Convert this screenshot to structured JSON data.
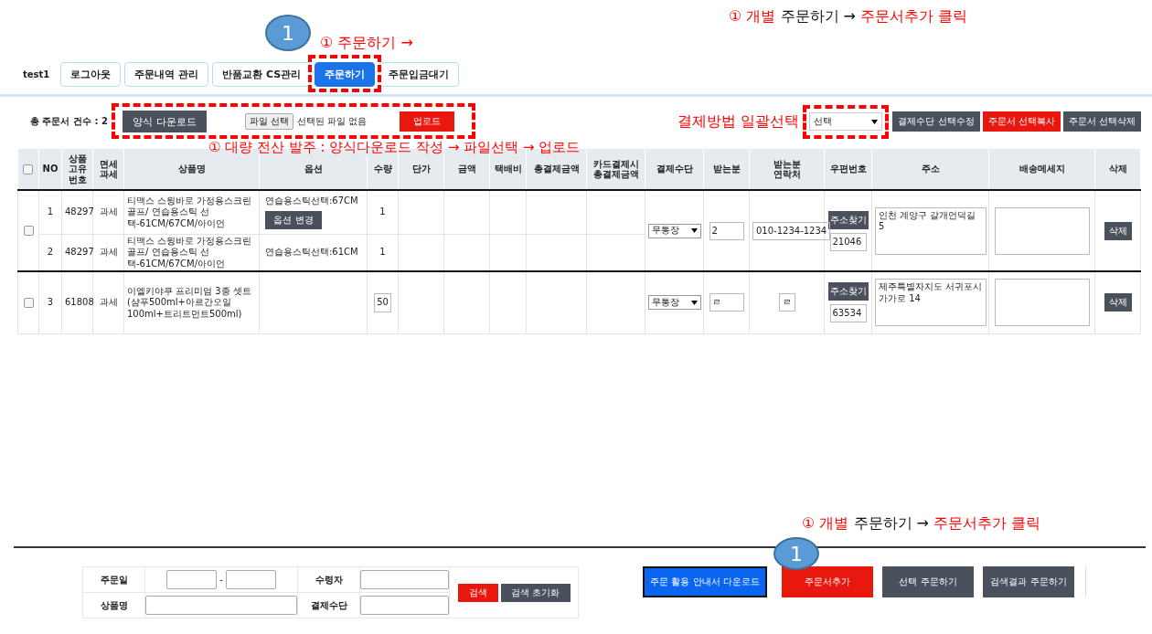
{
  "annotation_top": {
    "segments": [
      {
        "text": "① 개별",
        "emphasis": true
      },
      {
        "text": "주문하기 →",
        "emphasis": false
      },
      {
        "text": "주문서추가 클릭",
        "emphasis": true
      }
    ]
  },
  "step_badges": [
    "1",
    "1"
  ],
  "annotation_tab": "① 주문하기 →",
  "annotation_bulk": "① 대량 전산 발주 :  양식다운로드 작성 → 파일선택 →  업로드",
  "annotation_payment": "결제방법 일괄선택",
  "annotation_bottom": {
    "segments": [
      {
        "text": "① 개별",
        "emphasis": true
      },
      {
        "text": "주문하기 →",
        "emphasis": false
      },
      {
        "text": "주문서추가 클릭",
        "emphasis": true
      }
    ]
  },
  "user": "test1",
  "tabs": [
    {
      "label": "로그아웃",
      "selected": false
    },
    {
      "label": "주문내역 관리",
      "selected": false
    },
    {
      "label": "반품교환 CS관리",
      "selected": false
    },
    {
      "label": "주문하기",
      "selected": true
    },
    {
      "label": "주문입금대기",
      "selected": false
    }
  ],
  "order_count": "총 주문서 건수 : 2",
  "template_button": "양식 다운로드",
  "file_button": "파일 선택",
  "file_status": "선택된 파일 없음",
  "upload_button": "업로드",
  "payment_select": "선택",
  "toolbar_buttons": [
    {
      "label": "결제수단 선택수정",
      "kind": "dark"
    },
    {
      "label": "주문서 선택복사",
      "kind": "danger"
    },
    {
      "label": "주문서 선택삭제",
      "kind": "dark"
    }
  ],
  "table": {
    "all_checked": false,
    "columns": [
      "NO",
      "상품\n고유\n번호",
      "면세\n과세",
      "상품명",
      "옵션",
      "수량",
      "단가",
      "금액",
      "택배비",
      "총결제금액",
      "카드결제시\n총결제금액",
      "결제수단",
      "받는분",
      "받는분\n연락처",
      "우편번호",
      "주소",
      "배송메세지",
      "삭제"
    ],
    "orders": [
      {
        "checked": false,
        "payment": "무통장",
        "recipient": "2",
        "phone": "010-1234-1234",
        "zip_button": "주소찾기",
        "zip": "21046",
        "address": "인천 계양구 갈개언덕길 5",
        "delete_button": "삭제",
        "items": [
          {
            "no": "1",
            "code": "48297",
            "tax": "과세",
            "name": "티맥스 스윙바로 가정용스크린골프/ 연습용스틱 선택-61CM/67CM/아이언",
            "option": "연습용스틱선택:67CM",
            "option_button": "옵션 변경",
            "qty": "1",
            "qty_field": false
          },
          {
            "no": "2",
            "code": "48297",
            "tax": "과세",
            "name": "티맥스 스윙바로 가정용스크린골프/ 연습용스틱 선택-61CM/67CM/아이언",
            "option": "연습용스틱선택:61CM",
            "qty": "1",
            "qty_field": false
          }
        ]
      },
      {
        "checked": false,
        "payment": "무통장",
        "recipient": "ㄹ",
        "phone": "ㄹ",
        "zip_button": "주소찾기",
        "zip": "63534",
        "address": "제주특별자치도 서귀포시 가가로 14",
        "delete_button": "삭제",
        "items": [
          {
            "no": "3",
            "code": "61808",
            "tax": "과세",
            "name": "이엘키야쿠 프리미엄 3종 셋트(샴푸500ml+아르간오일100ml+트리트먼트500ml)",
            "qty": "50",
            "qty_field": true
          }
        ]
      }
    ]
  },
  "search": {
    "order_date_label": "주문일",
    "date_separator": "-",
    "receiver_label": "수령자",
    "product_label": "상품명",
    "payment_label": "결제수단",
    "search_button": "검색",
    "reset_button": "검색 초기화"
  },
  "footer_buttons": [
    {
      "label": "주문 활용 안내서 다운로드",
      "kind": "primary"
    },
    {
      "label": "주문서추가",
      "kind": "danger"
    },
    {
      "label": "선택 주문하기",
      "kind": "dark"
    },
    {
      "label": "검색결과 주문하기",
      "kind": "dark"
    }
  ]
}
